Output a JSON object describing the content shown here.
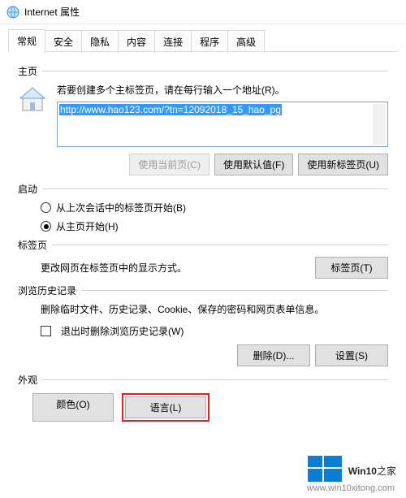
{
  "window": {
    "title": "Internet 属性"
  },
  "tabs": [
    "常规",
    "安全",
    "隐私",
    "内容",
    "连接",
    "程序",
    "高级"
  ],
  "active_tab": 0,
  "homepage": {
    "group": "主页",
    "hint": "若要创建多个主标签页，请在每行输入一个地址(R)。",
    "url": "http://www.hao123.com/?tn=12092018_15_hao_pg",
    "buttons": {
      "current": "使用当前页(C)",
      "default": "使用默认值(F)",
      "newtab": "使用新标签页(U)"
    }
  },
  "startup": {
    "group": "启动",
    "radio_last": "从上次会话中的标签页开始(B)",
    "radio_home": "从主页开始(H)"
  },
  "tabs_section": {
    "group": "标签页",
    "text": "更改网页在标签页中的显示方式。",
    "button": "标签页(T)"
  },
  "history": {
    "group": "浏览历史记录",
    "text": "删除临时文件、历史记录、Cookie、保存的密码和网页表单信息。",
    "checkbox": "退出时删除浏览历史记录(W)",
    "delete_btn": "删除(D)...",
    "settings_btn": "设置(S)"
  },
  "appearance": {
    "group": "外观",
    "color_btn": "颜色(O)",
    "lang_btn": "语言(L)"
  },
  "watermark": {
    "brand": "Win10",
    "suffix": "之家",
    "url": "www.win10xitong.com"
  }
}
